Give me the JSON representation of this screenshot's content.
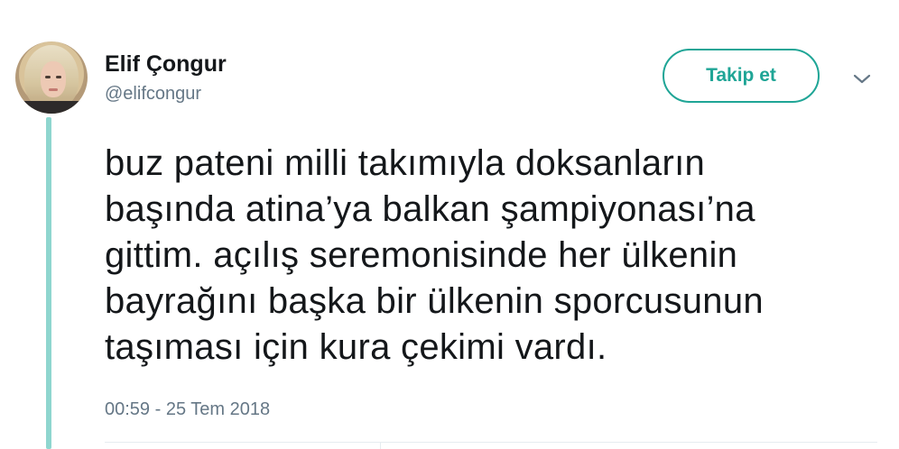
{
  "user": {
    "name": "Elif Çongur",
    "handle": "@elifcongur"
  },
  "follow_button": {
    "label": "Takip et"
  },
  "menu": {
    "icon": "chevron-down-icon"
  },
  "tweet": {
    "lines": [
      "buz pateni milli takımıyla doksanların",
      "başında atina’ya balkan şampiyonası’na",
      "gittim. açılış seremonisinde her ülkenin",
      "bayrağını başka bir ülkenin sporcusunun",
      "taşıması için kura çekimi vardı."
    ],
    "timestamp": "00:59 - 25 Tem 2018"
  },
  "colors": {
    "accent": "#1fa596",
    "thread_line": "#8fd6cf",
    "secondary_text": "#657786",
    "primary_text": "#14171a"
  }
}
